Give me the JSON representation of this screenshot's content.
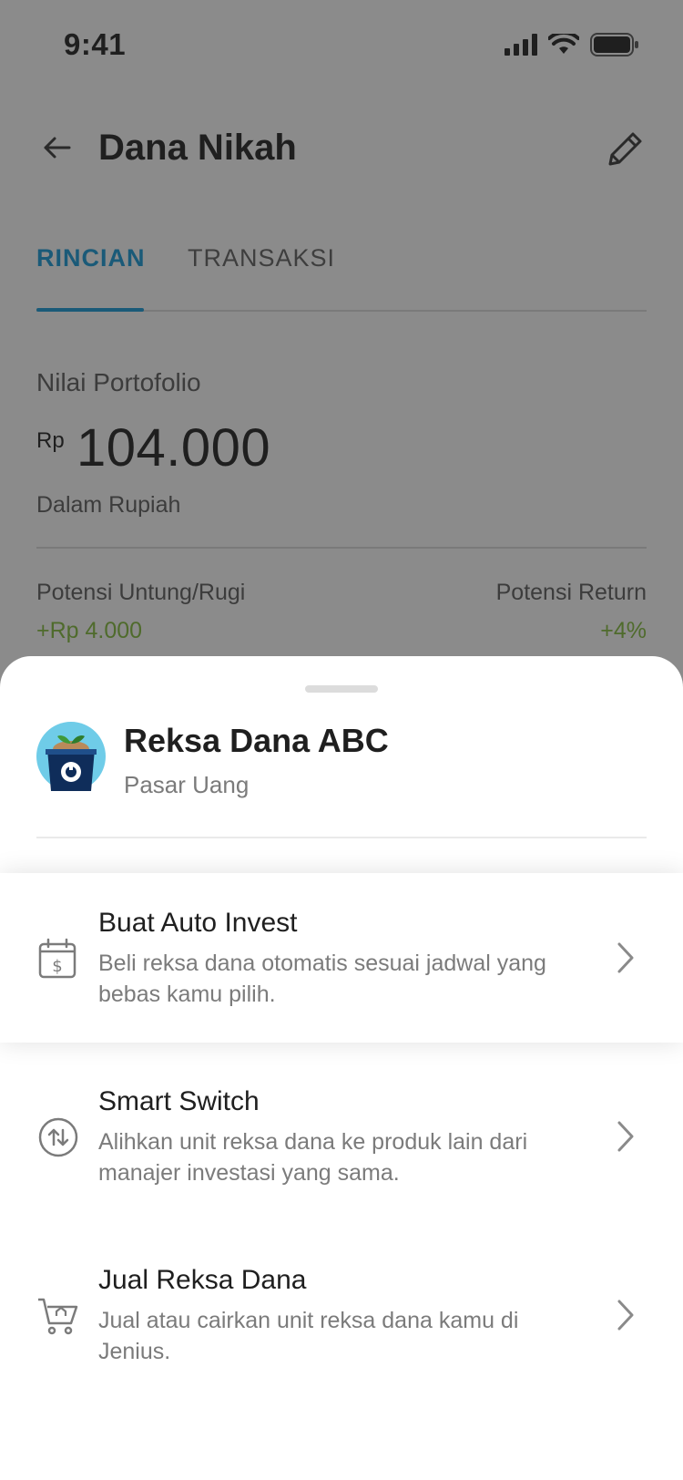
{
  "status_bar": {
    "time": "9:41"
  },
  "header": {
    "title": "Dana Nikah"
  },
  "tabs": [
    {
      "label": "RINCIAN",
      "active": true
    },
    {
      "label": "TRANSAKSI",
      "active": false
    }
  ],
  "portfolio": {
    "label": "Nilai Portofolio",
    "currency": "Rp",
    "amount": "104.000",
    "note": "Dalam Rupiah",
    "profit_label": "Potensi Untung/Rugi",
    "profit_value": "+Rp 4.000",
    "return_label": "Potensi Return",
    "return_value": "+4%"
  },
  "sheet": {
    "fund_name": "Reksa Dana ABC",
    "fund_type": "Pasar Uang",
    "options": [
      {
        "title": "Buat Auto Invest",
        "desc": "Beli reksa dana otomatis sesuai jadwal yang bebas kamu pilih.",
        "icon": "calendar-dollar-icon"
      },
      {
        "title": "Smart Switch",
        "desc": "Alihkan unit reksa dana ke produk lain dari manajer investasi yang sama.",
        "icon": "switch-arrows-icon"
      },
      {
        "title": "Jual Reksa Dana",
        "desc": "Jual atau cairkan unit reksa dana kamu di Jenius.",
        "icon": "cart-sell-icon"
      }
    ]
  },
  "colors": {
    "accent": "#1a5a78",
    "positive": "#4f6b2c",
    "overlay": "#8b8b8b"
  }
}
